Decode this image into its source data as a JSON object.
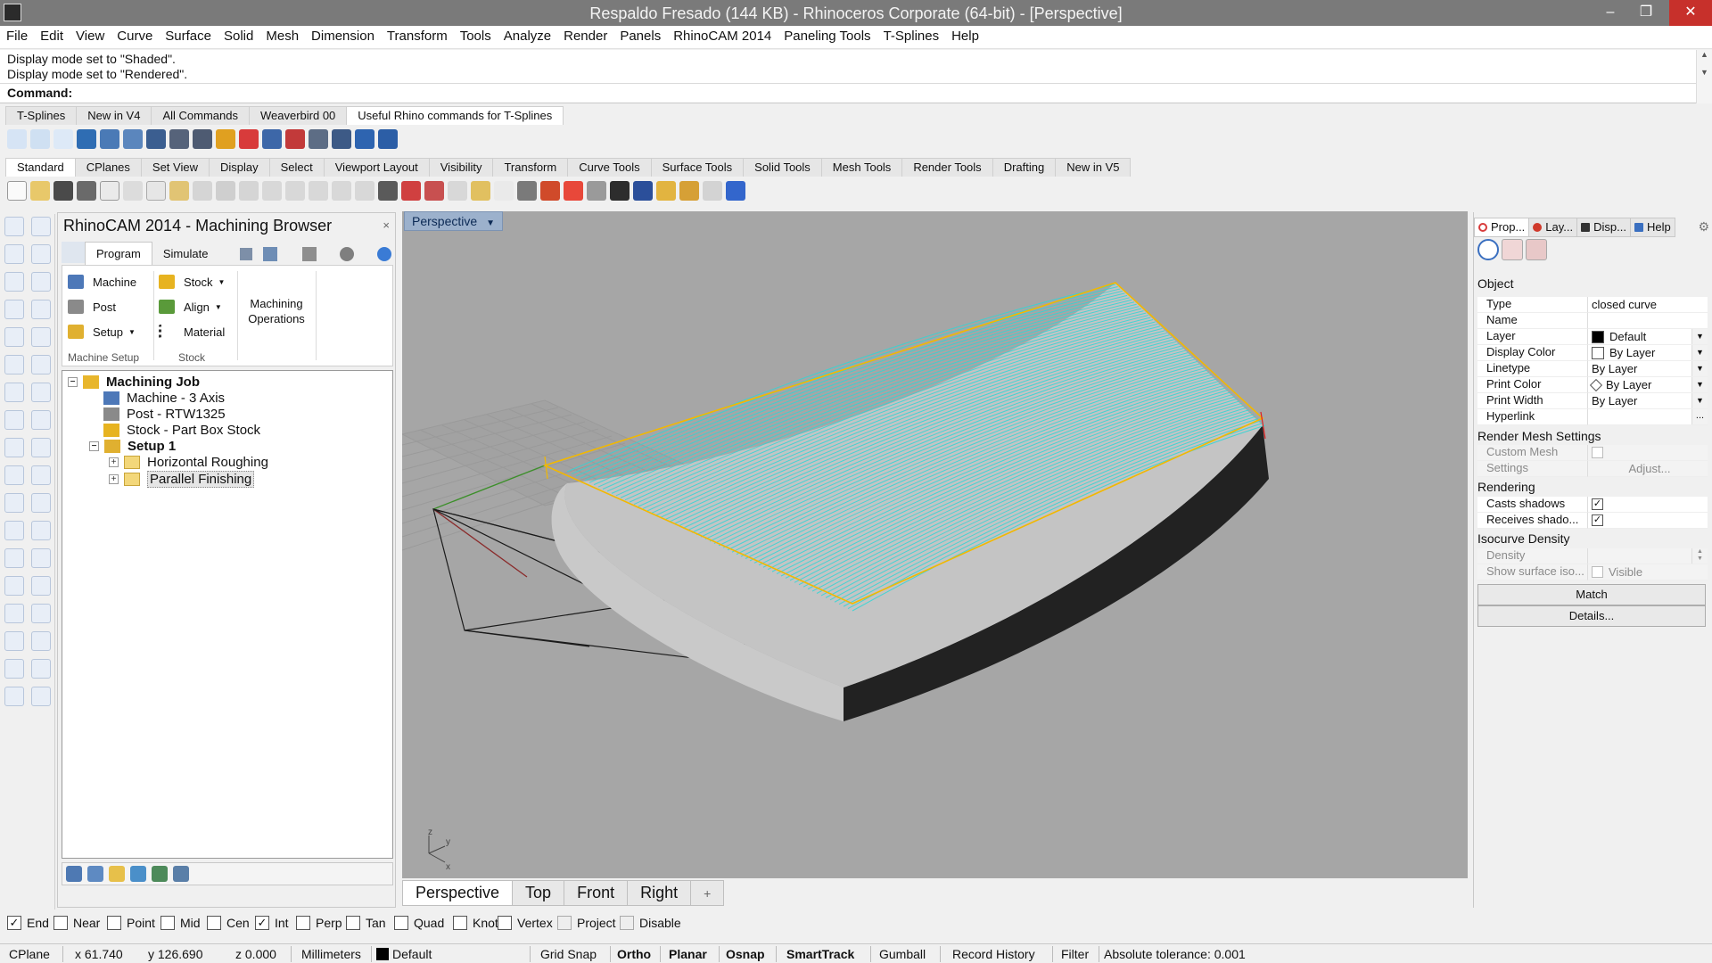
{
  "window": {
    "title": "Respaldo Fresado (144 KB) - Rhinoceros Corporate (64-bit) - [Perspective]",
    "minimize_glyph": "–",
    "maximize_glyph": "❐",
    "close_glyph": "✕"
  },
  "menu": [
    "File",
    "Edit",
    "View",
    "Curve",
    "Surface",
    "Solid",
    "Mesh",
    "Dimension",
    "Transform",
    "Tools",
    "Analyze",
    "Render",
    "Panels",
    "RhinoCAM 2014",
    "Paneling Tools",
    "T-Splines",
    "Help"
  ],
  "command": {
    "history": [
      "Display mode set to \"Shaded\".",
      "Display mode set to \"Rendered\"."
    ],
    "prompt": "Command:"
  },
  "toolbar_tabs_top": [
    "T-Splines",
    "New in V4",
    "All Commands",
    "Weaverbird 00",
    "Useful Rhino commands for T-Splines"
  ],
  "toolbar_tabs_main": [
    "Standard",
    "CPlanes",
    "Set View",
    "Display",
    "Select",
    "Viewport Layout",
    "Visibility",
    "Transform",
    "Curve Tools",
    "Surface Tools",
    "Solid Tools",
    "Mesh Tools",
    "Render Tools",
    "Drafting",
    "New in V5"
  ],
  "browser": {
    "title": "RhinoCAM 2014 - Machining Browser",
    "close_glyph": "×",
    "tabs": [
      "Program",
      "Simulate"
    ],
    "ribbon": {
      "machine": "Machine",
      "post": "Post",
      "setup": "Setup",
      "stock": "Stock",
      "align": "Align",
      "material": "Material",
      "machining_operations": "Machining Operations",
      "group_machine_setup": "Machine Setup",
      "group_stock": "Stock"
    },
    "tree": {
      "job": "Machining Job",
      "machine": "Machine - 3 Axis",
      "post": "Post - RTW1325",
      "stock": "Stock - Part Box Stock",
      "setup": "Setup 1",
      "op1": "Horizontal Roughing",
      "op2": "Parallel Finishing"
    }
  },
  "viewport": {
    "label": "Perspective",
    "axis_z": "z",
    "axis_y": "y",
    "axis_x": "x",
    "colors": {
      "background": "#a6a6a6",
      "toolpath": "#2fd6d6",
      "boundary": "#f2b800"
    }
  },
  "viewport_tabs": [
    "Perspective",
    "Top",
    "Front",
    "Right"
  ],
  "viewport_tab_plus": "+",
  "properties": {
    "tabs": [
      "Prop...",
      "Lay...",
      "Disp...",
      "Help"
    ],
    "section_object": "Object",
    "rows": [
      {
        "key": "Type",
        "value": "closed curve"
      },
      {
        "key": "Name",
        "value": ""
      },
      {
        "key": "Layer",
        "value": "Default"
      },
      {
        "key": "Display Color",
        "value": "By Layer"
      },
      {
        "key": "Linetype",
        "value": "By Layer"
      },
      {
        "key": "Print Color",
        "value": "By Layer"
      },
      {
        "key": "Print Width",
        "value": "By Layer"
      },
      {
        "key": "Hyperlink",
        "value": ""
      }
    ],
    "hyperlink_button": "...",
    "section_render_mesh": "Render Mesh Settings",
    "custom_mesh": "Custom Mesh",
    "settings": "Settings",
    "adjust": "Adjust...",
    "section_rendering": "Rendering",
    "casts_shadows": "Casts shadows",
    "receives_shadows": "Receives shado...",
    "section_isocurve": "Isocurve Density",
    "density": "Density",
    "show_surface_iso": "Show surface iso...",
    "visible": "Visible",
    "match_button": "Match",
    "details_button": "Details..."
  },
  "osnaps": [
    {
      "label": "End",
      "checked": true
    },
    {
      "label": "Near",
      "checked": false
    },
    {
      "label": "Point",
      "checked": false
    },
    {
      "label": "Mid",
      "checked": false
    },
    {
      "label": "Cen",
      "checked": false
    },
    {
      "label": "Int",
      "checked": true
    },
    {
      "label": "Perp",
      "checked": false
    },
    {
      "label": "Tan",
      "checked": false
    },
    {
      "label": "Quad",
      "checked": false
    },
    {
      "label": "Knot",
      "checked": false
    },
    {
      "label": "Vertex",
      "checked": false
    },
    {
      "label": "Project",
      "checked": false
    },
    {
      "label": "Disable",
      "checked": false
    }
  ],
  "status": {
    "cplane": "CPlane",
    "x": "x 61.740",
    "y": "y 126.690",
    "z": "z 0.000",
    "units": "Millimeters",
    "layer": "Default",
    "grid_snap": "Grid Snap",
    "ortho": "Ortho",
    "planar": "Planar",
    "osnap": "Osnap",
    "smarttrack": "SmartTrack",
    "gumball": "Gumball",
    "record_history": "Record History",
    "filter": "Filter",
    "tolerance": "Absolute tolerance: 0.001"
  },
  "checkmark": "✓"
}
